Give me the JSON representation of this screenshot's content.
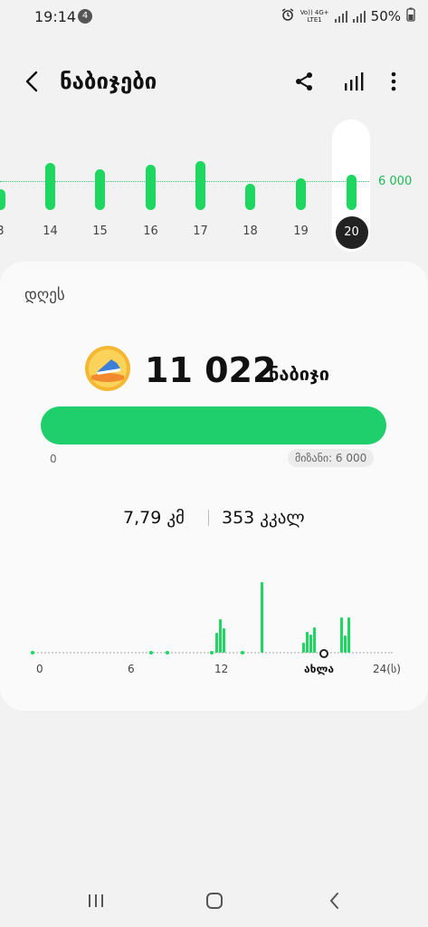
{
  "status": {
    "time": "19:14",
    "notification_count": "4",
    "network_line1": "Vo)) 4G+",
    "network_line2": "LTE1",
    "battery": "50%"
  },
  "header": {
    "title": "ნაბიჯები",
    "icons": [
      "back-icon",
      "share-icon",
      "chart-icon",
      "more-icon"
    ]
  },
  "week": {
    "goal_label": "6 000",
    "days": [
      {
        "label": "3",
        "value": 4300
      },
      {
        "label": "14",
        "value": 9800
      },
      {
        "label": "15",
        "value": 8400
      },
      {
        "label": "16",
        "value": 9400
      },
      {
        "label": "17",
        "value": 10100
      },
      {
        "label": "18",
        "value": 5500
      },
      {
        "label": "19",
        "value": 6500
      },
      {
        "label": "20",
        "value": 7300,
        "selected": true
      }
    ]
  },
  "today": {
    "period": "დღეს",
    "steps_value": "11 022",
    "steps_unit": "ნაბიჯი",
    "progress": 1.0,
    "progress_min": "0",
    "goal_text": "მიზანი: 6 000",
    "distance": "7,79 კმ",
    "calories": "353 კკალ"
  },
  "hourly": {
    "labels": [
      "0",
      "6",
      "12",
      "ახლა",
      "24(ს)"
    ],
    "bars": [
      0,
      0,
      0,
      0,
      0,
      0,
      0,
      0,
      0,
      0,
      0,
      0,
      0,
      0,
      0,
      0,
      0,
      0,
      0,
      0,
      0,
      0,
      0,
      0,
      0,
      0,
      0,
      0,
      0,
      0,
      0,
      0,
      0,
      0,
      0,
      0,
      0,
      0,
      0,
      0,
      0,
      0,
      0,
      0,
      0,
      0,
      0,
      0,
      0.28,
      0.48,
      0.34,
      0,
      0,
      0,
      0,
      0,
      0,
      0,
      0,
      0,
      1.0,
      0,
      0,
      0,
      0,
      0,
      0,
      0,
      0,
      0,
      0,
      0.14,
      0.3,
      0.26,
      0.36,
      0,
      0,
      0,
      0,
      0,
      0,
      0.5,
      0.24,
      0.5,
      0
    ]
  },
  "colors": {
    "accent": "#1ed760",
    "progress": "#1fcf6b",
    "background": "#f2f2f2",
    "card": "#fafafa"
  }
}
